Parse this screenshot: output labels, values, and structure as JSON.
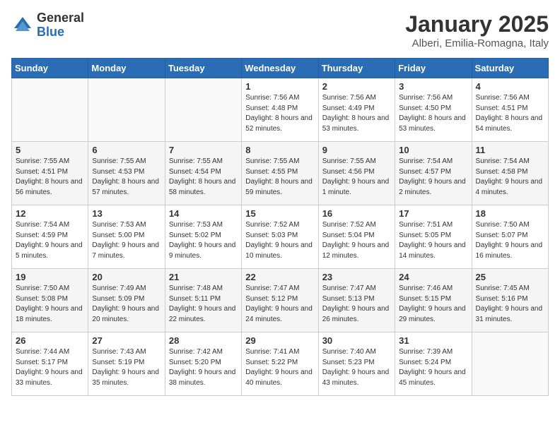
{
  "header": {
    "logo_general": "General",
    "logo_blue": "Blue",
    "month_title": "January 2025",
    "location": "Alberi, Emilia-Romagna, Italy"
  },
  "days_of_week": [
    "Sunday",
    "Monday",
    "Tuesday",
    "Wednesday",
    "Thursday",
    "Friday",
    "Saturday"
  ],
  "weeks": [
    [
      {
        "day": "",
        "info": ""
      },
      {
        "day": "",
        "info": ""
      },
      {
        "day": "",
        "info": ""
      },
      {
        "day": "1",
        "info": "Sunrise: 7:56 AM\nSunset: 4:48 PM\nDaylight: 8 hours and 52 minutes."
      },
      {
        "day": "2",
        "info": "Sunrise: 7:56 AM\nSunset: 4:49 PM\nDaylight: 8 hours and 53 minutes."
      },
      {
        "day": "3",
        "info": "Sunrise: 7:56 AM\nSunset: 4:50 PM\nDaylight: 8 hours and 53 minutes."
      },
      {
        "day": "4",
        "info": "Sunrise: 7:56 AM\nSunset: 4:51 PM\nDaylight: 8 hours and 54 minutes."
      }
    ],
    [
      {
        "day": "5",
        "info": "Sunrise: 7:55 AM\nSunset: 4:51 PM\nDaylight: 8 hours and 56 minutes."
      },
      {
        "day": "6",
        "info": "Sunrise: 7:55 AM\nSunset: 4:53 PM\nDaylight: 8 hours and 57 minutes."
      },
      {
        "day": "7",
        "info": "Sunrise: 7:55 AM\nSunset: 4:54 PM\nDaylight: 8 hours and 58 minutes."
      },
      {
        "day": "8",
        "info": "Sunrise: 7:55 AM\nSunset: 4:55 PM\nDaylight: 8 hours and 59 minutes."
      },
      {
        "day": "9",
        "info": "Sunrise: 7:55 AM\nSunset: 4:56 PM\nDaylight: 9 hours and 1 minute."
      },
      {
        "day": "10",
        "info": "Sunrise: 7:54 AM\nSunset: 4:57 PM\nDaylight: 9 hours and 2 minutes."
      },
      {
        "day": "11",
        "info": "Sunrise: 7:54 AM\nSunset: 4:58 PM\nDaylight: 9 hours and 4 minutes."
      }
    ],
    [
      {
        "day": "12",
        "info": "Sunrise: 7:54 AM\nSunset: 4:59 PM\nDaylight: 9 hours and 5 minutes."
      },
      {
        "day": "13",
        "info": "Sunrise: 7:53 AM\nSunset: 5:00 PM\nDaylight: 9 hours and 7 minutes."
      },
      {
        "day": "14",
        "info": "Sunrise: 7:53 AM\nSunset: 5:02 PM\nDaylight: 9 hours and 9 minutes."
      },
      {
        "day": "15",
        "info": "Sunrise: 7:52 AM\nSunset: 5:03 PM\nDaylight: 9 hours and 10 minutes."
      },
      {
        "day": "16",
        "info": "Sunrise: 7:52 AM\nSunset: 5:04 PM\nDaylight: 9 hours and 12 minutes."
      },
      {
        "day": "17",
        "info": "Sunrise: 7:51 AM\nSunset: 5:05 PM\nDaylight: 9 hours and 14 minutes."
      },
      {
        "day": "18",
        "info": "Sunrise: 7:50 AM\nSunset: 5:07 PM\nDaylight: 9 hours and 16 minutes."
      }
    ],
    [
      {
        "day": "19",
        "info": "Sunrise: 7:50 AM\nSunset: 5:08 PM\nDaylight: 9 hours and 18 minutes."
      },
      {
        "day": "20",
        "info": "Sunrise: 7:49 AM\nSunset: 5:09 PM\nDaylight: 9 hours and 20 minutes."
      },
      {
        "day": "21",
        "info": "Sunrise: 7:48 AM\nSunset: 5:11 PM\nDaylight: 9 hours and 22 minutes."
      },
      {
        "day": "22",
        "info": "Sunrise: 7:47 AM\nSunset: 5:12 PM\nDaylight: 9 hours and 24 minutes."
      },
      {
        "day": "23",
        "info": "Sunrise: 7:47 AM\nSunset: 5:13 PM\nDaylight: 9 hours and 26 minutes."
      },
      {
        "day": "24",
        "info": "Sunrise: 7:46 AM\nSunset: 5:15 PM\nDaylight: 9 hours and 29 minutes."
      },
      {
        "day": "25",
        "info": "Sunrise: 7:45 AM\nSunset: 5:16 PM\nDaylight: 9 hours and 31 minutes."
      }
    ],
    [
      {
        "day": "26",
        "info": "Sunrise: 7:44 AM\nSunset: 5:17 PM\nDaylight: 9 hours and 33 minutes."
      },
      {
        "day": "27",
        "info": "Sunrise: 7:43 AM\nSunset: 5:19 PM\nDaylight: 9 hours and 35 minutes."
      },
      {
        "day": "28",
        "info": "Sunrise: 7:42 AM\nSunset: 5:20 PM\nDaylight: 9 hours and 38 minutes."
      },
      {
        "day": "29",
        "info": "Sunrise: 7:41 AM\nSunset: 5:22 PM\nDaylight: 9 hours and 40 minutes."
      },
      {
        "day": "30",
        "info": "Sunrise: 7:40 AM\nSunset: 5:23 PM\nDaylight: 9 hours and 43 minutes."
      },
      {
        "day": "31",
        "info": "Sunrise: 7:39 AM\nSunset: 5:24 PM\nDaylight: 9 hours and 45 minutes."
      },
      {
        "day": "",
        "info": ""
      }
    ]
  ]
}
